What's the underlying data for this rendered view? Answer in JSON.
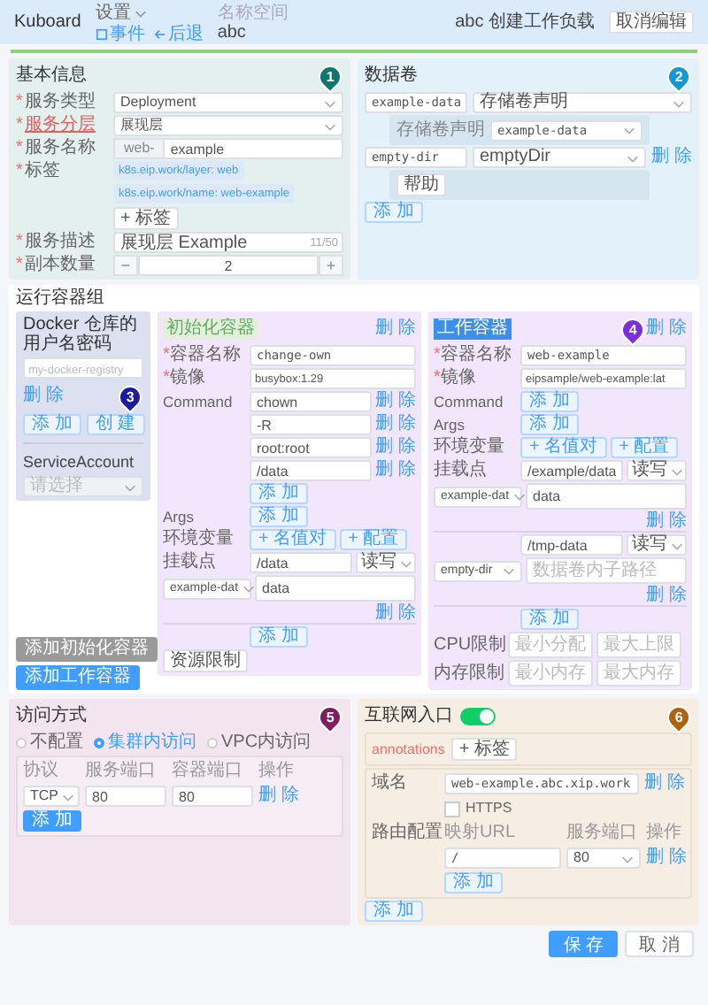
{
  "header": {
    "logo": "Kuboard",
    "menu": "设置",
    "links": [
      {
        "kind": "events",
        "label": "事件"
      },
      {
        "kind": "back",
        "label": "后退"
      }
    ],
    "namespace_label": "名称空间",
    "namespace": "abc",
    "title": "abc 创建工作负载",
    "cancel_button": "取消编辑"
  },
  "progress": {
    "level": 1
  },
  "markers": [
    {
      "label": "1",
      "color": "#10756d"
    },
    {
      "label": "2",
      "color": "#1796d4"
    },
    {
      "label": "3",
      "color": "#1b1ca0"
    },
    {
      "label": "4",
      "color": "#7a2fd8"
    },
    {
      "label": "5",
      "color": "#7b1f5e"
    },
    {
      "label": "6",
      "color": "#ad6310"
    }
  ],
  "basic": {
    "title": "基本信息",
    "fields": [
      {
        "kind": "select",
        "mark": "*",
        "label": "服务类型",
        "highlighted": false,
        "value": "Deployment"
      },
      {
        "kind": "select",
        "mark": "*",
        "label": "服务分层",
        "highlighted": true,
        "value": "展现层"
      },
      {
        "kind": "prefixed",
        "mark": "*",
        "label": "服务名称",
        "highlighted": false,
        "prefix": "web-",
        "value": "example"
      },
      {
        "kind": "tags",
        "mark": "*",
        "label": "标签",
        "highlighted": false,
        "tags": [
          "k8s.eip.work/layer: web",
          "k8s.eip.work/name: web-example"
        ],
        "button": "+ 标签"
      },
      {
        "kind": "counted",
        "mark": "*",
        "label": "服务描述",
        "highlighted": false,
        "value": "展现层 Example",
        "count": "11/50"
      },
      {
        "kind": "stepper",
        "mark": "*",
        "label": "副本数量",
        "highlighted": false,
        "minus": "−",
        "value": "2",
        "plus": "+"
      }
    ]
  },
  "volumes": {
    "title": "数据卷",
    "items": [
      {
        "name": "example-data",
        "type": "存储卷声明",
        "detail": {
          "kind": "claim",
          "label": "存储卷声明",
          "value": "example-data"
        }
      },
      {
        "name": "empty-dir",
        "type": "emptyDir",
        "delete": "删 除",
        "detail": {
          "kind": "help",
          "button": "帮助"
        }
      }
    ],
    "add_button": "添 加"
  },
  "containers": {
    "title": "运行容器组",
    "registry": {
      "label": "Docker 仓库的用户名密码",
      "placeholder": "my-docker-registry",
      "delete": "删 除",
      "buttons": [
        "添 加",
        "创 建"
      ]
    },
    "service_account": {
      "label": "ServiceAccount",
      "placeholder": "请选择"
    },
    "cards": [
      {
        "tag": "初始化容器",
        "tag_highlighted": false,
        "delete": "删 除",
        "mark": "*",
        "name_label": "容器名称",
        "name": "change-own",
        "image_label": "镜像",
        "image": "busybox:1.29",
        "command_label": "Command",
        "command": [
          {
            "value": "chown",
            "delete": "删 除"
          },
          {
            "value": "-R",
            "delete": "删 除"
          },
          {
            "value": "root:root",
            "delete": "删 除"
          },
          {
            "value": "/data",
            "delete": "删 除"
          }
        ],
        "command_add": "添 加",
        "args_label": "Args",
        "args_add": "添 加",
        "env_label": "环境变量",
        "env_buttons": [
          "+ 名值对",
          "+ 配置"
        ],
        "mount_label": "挂载点",
        "mounts": [
          {
            "path": "/data",
            "mode": "读写",
            "volume": "example-dat",
            "sub_path": "data",
            "delete": "删 除"
          }
        ],
        "mount_add": "添 加",
        "resource_button": "资源限制"
      },
      {
        "tag": "工作容器",
        "tag_highlighted": true,
        "delete": "删 除",
        "mark": "*",
        "name_label": "容器名称",
        "name": "web-example",
        "image_label": "镜像",
        "image": "eipsample/web-example:lat",
        "command_label": "Command",
        "command_add": "添 加",
        "args_label": "Args",
        "args_add": "添 加",
        "env_label": "环境变量",
        "env_buttons": [
          "+ 名值对",
          "+ 配置"
        ],
        "mount_label": "挂载点",
        "mounts": [
          {
            "path": "/example/data",
            "mode": "读写",
            "volume": "example-dat",
            "sub_path": "data",
            "delete": "删 除"
          },
          {
            "path": "/tmp-data",
            "mode": "读写",
            "volume": "empty-dir",
            "sub_placeholder": "数据卷内子路径",
            "delete": "删 除"
          }
        ],
        "mount_add": "添 加",
        "limits": [
          {
            "label": "CPU限制",
            "placeholders": [
              "最小分配",
              "最大上限"
            ]
          },
          {
            "label": "内存限制",
            "placeholders": [
              "最小内存",
              "最大内存"
            ]
          }
        ]
      }
    ],
    "buttons": [
      {
        "kind": "grey",
        "label": "添加初始化容器"
      },
      {
        "kind": "primary",
        "label": "添加工作容器"
      }
    ]
  },
  "access": {
    "title": "访问方式",
    "options": [
      {
        "label": "不配置",
        "selected": false
      },
      {
        "label": "集群内访问",
        "selected": true
      },
      {
        "label": "VPC内访问",
        "selected": false
      }
    ],
    "columns": [
      "协议",
      "服务端口",
      "容器端口",
      "操作"
    ],
    "rows": [
      {
        "protocol": "TCP",
        "port": "80",
        "target_port": "80",
        "delete": "删 除"
      }
    ],
    "add_button": "添 加"
  },
  "ingress": {
    "label": "互联网入口",
    "on": true,
    "annotations_label": "annotations",
    "annotations_button": "+ 标签",
    "domain_label": "域名",
    "domain": "web-example.abc.xip.work",
    "domain_delete": "删 除",
    "https": {
      "label": "HTTPS",
      "checked": false
    },
    "routes_label": "路由配置",
    "route_columns": [
      "映射URL",
      "服务端口",
      "操作"
    ],
    "routes": [
      {
        "path": "/",
        "port": "80",
        "delete": "删 除"
      }
    ],
    "route_add": "添 加",
    "add_button": "添 加"
  },
  "footer": {
    "save": "保 存",
    "cancel": "取 消"
  }
}
